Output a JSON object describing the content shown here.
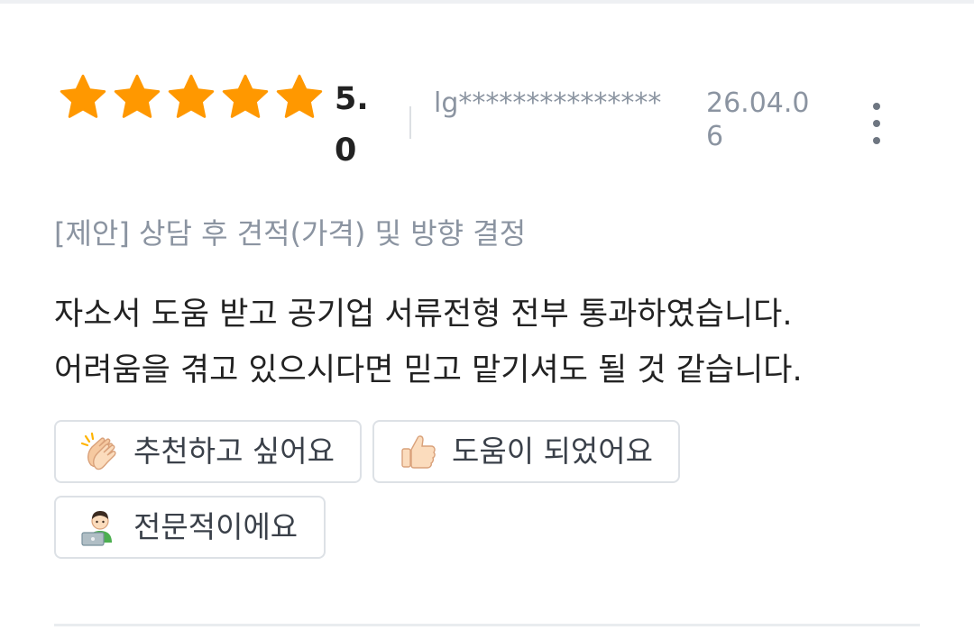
{
  "review": {
    "star_count": 5,
    "rating": "5.0",
    "author": "lg***************",
    "date": "26.04.06",
    "more_icon": "more-vertical-icon",
    "proposal": "[제안] 상담 후 견적(가격) 및 방향 결정",
    "text_lines": [
      "자소서 도움 받고 공기업 서류전형 전부 통과하였습니다.",
      "어려움을 겪고 있으시다면 믿고 맡기셔도 될 것 같습니다."
    ]
  },
  "reactions": [
    {
      "label": "추천하고 싶어요",
      "icon": "clapping-hands-icon"
    },
    {
      "label": "도움이 되었어요",
      "icon": "thumbs-up-icon"
    },
    {
      "label": "전문적이에요",
      "icon": "technologist-icon"
    }
  ],
  "colors": {
    "star": "#ff9800",
    "meta_text": "#8b94a1",
    "body_text": "#222222",
    "chip_border": "#dde1e6"
  }
}
